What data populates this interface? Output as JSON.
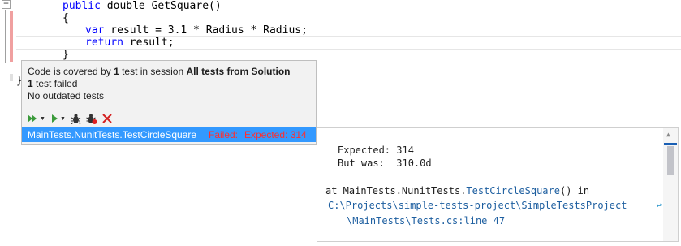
{
  "code": {
    "line1": {
      "kw": "public",
      "rest": " double GetSquare()"
    },
    "line2": "{",
    "line3": {
      "kw": "var",
      "rest": " result = 3.1 * Radius * Radius;"
    },
    "line4": {
      "kw": "return",
      "rest": " result;"
    },
    "line5": "}",
    "line6": "}"
  },
  "popup": {
    "coverage_prefix": "Code is covered by ",
    "coverage_count": "1",
    "coverage_mid": " test in session ",
    "session_name": "All tests from Solution",
    "failed_count": "1",
    "failed_suffix": " test failed",
    "outdated": "No outdated tests",
    "toolbar": {
      "run_all_icon": "run-all-icon",
      "run_icon": "run-icon",
      "debug_icon": "bug-icon",
      "debug_failed_icon": "bug-failed-icon",
      "close_icon": "close-icon"
    },
    "result": {
      "test_name": "MainTests.NunitTests.TestCircleSquare",
      "status": "Failed:",
      "message": "Expected: 314"
    }
  },
  "details": {
    "expected_line": "Expected: 314",
    "but_was_line": "But was:  310.0d",
    "at_prefix": "at MainTests.NunitTests.",
    "method_link": "TestCircleSquare",
    "at_suffix": "() in",
    "path_line1": "C:\\Projects\\simple-tests-project\\SimpleTestsProject",
    "path_line2": "\\MainTests\\Tests.cs:line 47"
  },
  "colors": {
    "selection": "#3399ff",
    "failed_text": "#ff2e2e",
    "keyword": "#0000ff",
    "link": "#1e5fa0"
  }
}
